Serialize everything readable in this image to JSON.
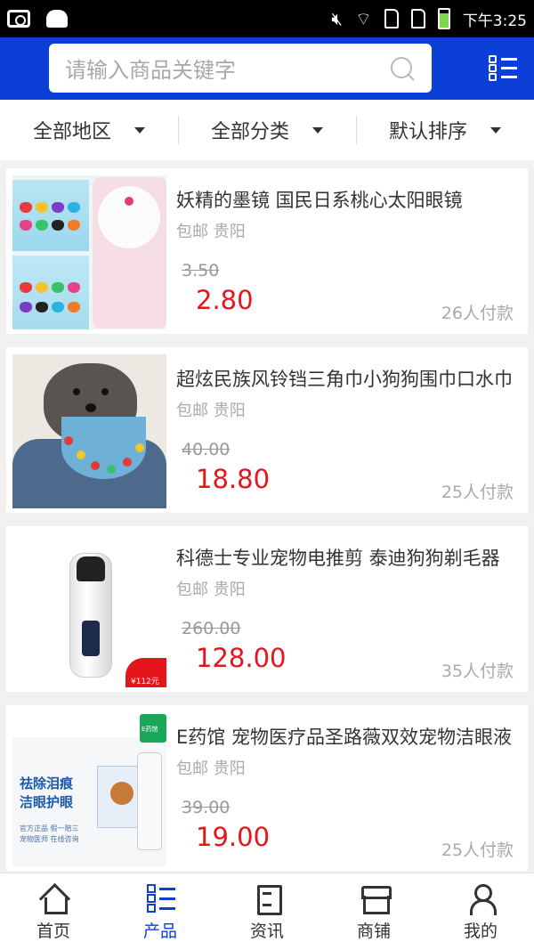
{
  "status_bar": {
    "time": "下午3:25",
    "icons": [
      "camera-icon",
      "android-icon",
      "mute-icon",
      "wifi-icon",
      "sim-icon",
      "sim-icon",
      "battery-icon"
    ]
  },
  "header": {
    "search_placeholder": "请输入商品关键字",
    "colors": {
      "brand": "#0c3fd6",
      "price": "#e4161b"
    }
  },
  "filters": [
    {
      "label": "全部地区"
    },
    {
      "label": "全部分类"
    },
    {
      "label": "默认排序"
    }
  ],
  "products": [
    {
      "title": "妖精的墨镜 国民日系桃心太阳眼镜",
      "location": "包邮 贵阳",
      "original_price": "3.50",
      "price": "2.80",
      "sold": "26人付款"
    },
    {
      "title": "超炫民族风铃铛三角巾小狗狗围巾口水巾",
      "location": "包邮 贵阳",
      "original_price": "40.00",
      "price": "18.80",
      "sold": "25人付款"
    },
    {
      "title": "科德士专业宠物电推剪 泰迪狗狗剃毛器",
      "location": "包邮 贵阳",
      "original_price": "260.00",
      "price": "128.00",
      "sold": "35人付款"
    },
    {
      "title": "E药馆 宠物医疗品圣路薇双效宠物洁眼液",
      "location": "包邮 贵阳",
      "original_price": "39.00",
      "price": "19.00",
      "sold": "25人付款"
    }
  ],
  "thumb_text": {
    "clipper_tag": "¥112元",
    "eye_heading_1": "祛除泪痕",
    "eye_heading_2": "洁眼护眼",
    "eye_fine_1": "官方正品 假一赔三",
    "eye_fine_2": "宠物医师 在线咨询",
    "eye_badge": "E药馆"
  },
  "bottom_nav": [
    {
      "label": "首页",
      "icon": "home-icon",
      "active": false
    },
    {
      "label": "产品",
      "icon": "grid-list-icon",
      "active": true
    },
    {
      "label": "资讯",
      "icon": "news-icon",
      "active": false
    },
    {
      "label": "商铺",
      "icon": "shop-icon",
      "active": false
    },
    {
      "label": "我的",
      "icon": "user-icon",
      "active": false
    }
  ]
}
